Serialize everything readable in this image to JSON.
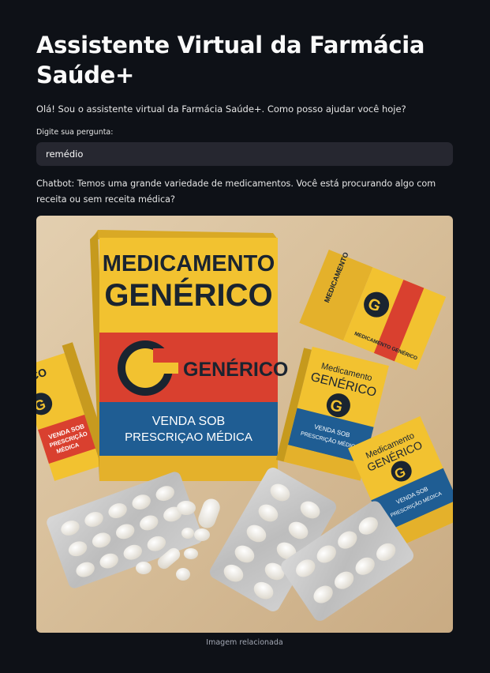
{
  "page": {
    "title": "Assistente Virtual da Farmácia Saúde+",
    "intro": "Olá! Sou o assistente virtual da Farmácia Saúde+. Como posso ajudar você hoje?"
  },
  "question": {
    "label": "Digite sua pergunta:",
    "value": "remédio"
  },
  "chatbot": {
    "response": "Chatbot: Temos uma grande variedade de medicamentos. Você está procurando algo com receita ou sem receita médica?"
  },
  "image": {
    "caption": "Imagem relacionada",
    "big_box": {
      "line1": "MEDICAMENTO",
      "line2": "GENÉRICO",
      "logo_letter": "G",
      "brand": "GENÉRICO",
      "rx_line1": "VENDA SOB",
      "rx_line2": "PRESCRIÇAO MÉDICA"
    },
    "small_box_right": {
      "side_text": "MEDICAMENTO",
      "logo_letter": "G",
      "front_text": "MEDICAMENTO GENÉRICO"
    },
    "box_center": {
      "line1": "Medicamento",
      "line2": "GENÉRICO",
      "logo_letter": "G",
      "rx_line1": "VENDA SOB",
      "rx_line2": "PRESCRIÇÃO MÉDICA"
    },
    "box_left": {
      "line1": "ICO",
      "logo_letter": "G",
      "rx_line1": "VENDA SOB",
      "rx_line2": "PRESCRIÇÃO",
      "rx_line3": "MÉDICA"
    },
    "box_far_right": {
      "line1": "Medicamento",
      "line2": "GENÉRICO",
      "logo_letter": "G",
      "rx_line1": "VENDA SOB",
      "rx_line2": "PRESCRIÇÃO MÉDICA"
    },
    "colors": {
      "yellow": "#f2c230",
      "red": "#d9402f",
      "blue": "#1f5d93",
      "dark": "#1a2430",
      "pill": "#f4f1ea"
    }
  }
}
